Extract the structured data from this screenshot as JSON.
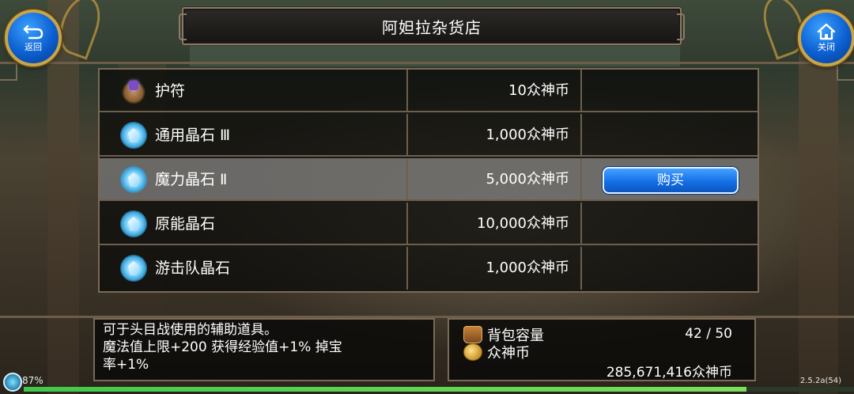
{
  "header": {
    "title": "阿妲拉杂货店",
    "back_label": "返回",
    "close_label": "关闭"
  },
  "shop": {
    "items": [
      {
        "name": "护符",
        "price": "10众神币",
        "icon": "amulet-icon"
      },
      {
        "name": "通用晶石 Ⅲ",
        "price": "1,000众神币",
        "icon": "crystal-icon"
      },
      {
        "name": "魔力晶石 Ⅱ",
        "price": "5,000众神币",
        "icon": "crystal-icon",
        "selected": true
      },
      {
        "name": "原能晶石",
        "price": "10,000众神币",
        "icon": "crystal-icon"
      },
      {
        "name": "游击队晶石",
        "price": "1,000众神币",
        "icon": "crystal-icon"
      }
    ],
    "buy_label": "购买"
  },
  "description": {
    "line1": "可于头目战使用的辅助道具。",
    "line2": "魔法值上限+200 获得经验值+1% 掉宝",
    "line3": "率+1%"
  },
  "inventory": {
    "bag_label": "背包容量",
    "bag_value": "42 / 50",
    "currency_label": "众神币",
    "currency_value": "285,671,416众神币"
  },
  "status": {
    "battery": "87%",
    "version": "2.5.2a(54)",
    "progress": 0.87
  }
}
